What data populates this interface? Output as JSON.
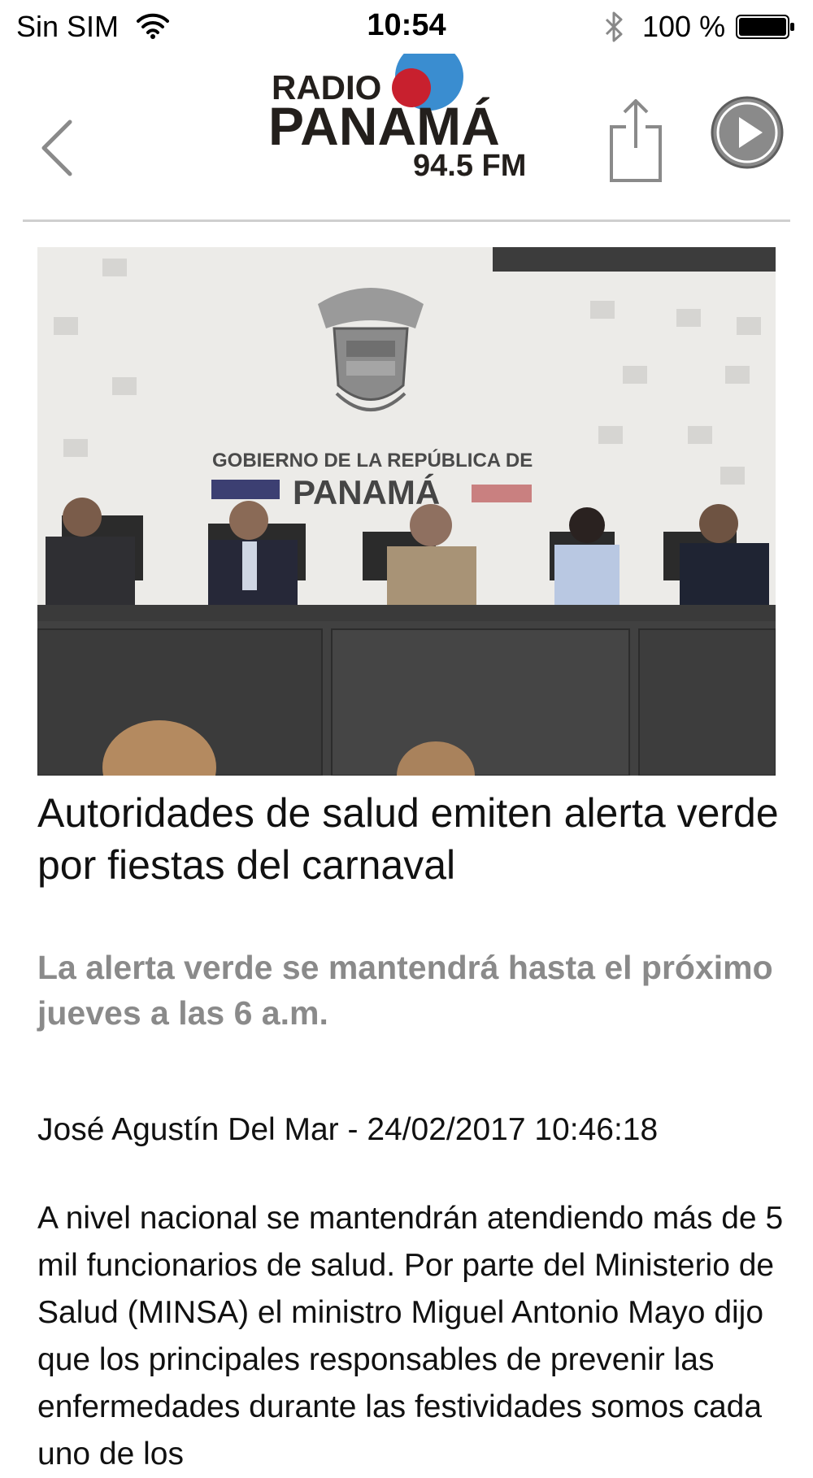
{
  "status_bar": {
    "carrier": "Sin SIM",
    "time": "10:54",
    "battery_percent": "100 %",
    "icons": [
      "wifi-icon",
      "bluetooth-icon",
      "battery-icon"
    ]
  },
  "header": {
    "logo": {
      "line1": "RADIO",
      "line2": "PANAMÁ",
      "line3": "94.5 FM",
      "colors": {
        "red": "#c8202e",
        "blue": "#3a8dd0",
        "text": "#231f1c"
      }
    },
    "icons": [
      "back-chevron-icon",
      "share-icon",
      "play-icon"
    ]
  },
  "photo": {
    "backdrop_line1": "GOBIERNO DE LA REPÚBLICA DE",
    "backdrop_line2": "PANAMÁ"
  },
  "article": {
    "title": "Autoridades de salud emiten alerta verde por fiestas del carnaval",
    "subtitle": "La alerta verde se mantendrá hasta el próximo jueves a las 6 a.m.",
    "byline": "José Agustín Del Mar - 24/02/2017 10:46:18",
    "body": "A nivel nacional se mantendrán atendiendo más de 5 mil funcionarios de salud. Por parte del Ministerio de Salud (MINSA) el ministro Miguel Antonio Mayo dijo que los principales responsables de prevenir las enfermedades durante las festividades somos cada uno de los"
  }
}
